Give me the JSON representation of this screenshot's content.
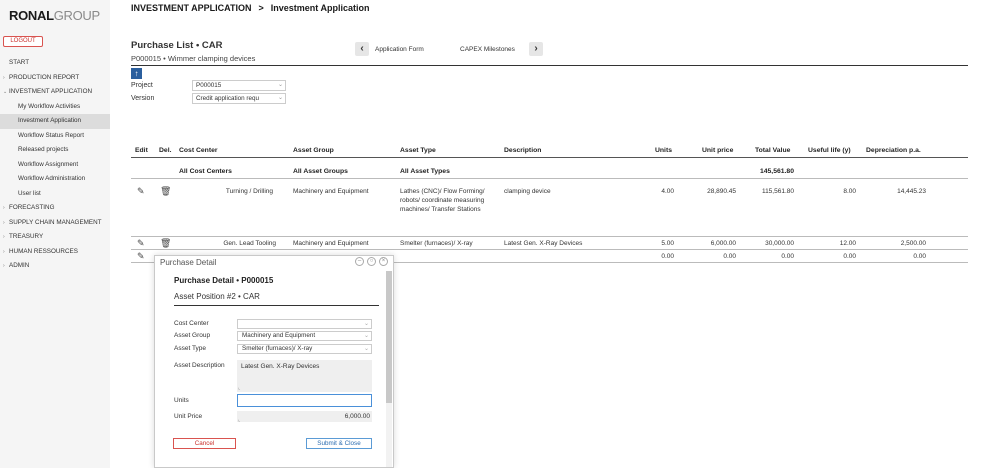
{
  "sidebar": {
    "logo_bold": "RONAL",
    "logo_light": "GROUP",
    "logout_label": "LOGOUT",
    "items": [
      {
        "label": "START"
      },
      {
        "label": "PRODUCTION REPORT"
      },
      {
        "label": "INVESTMENT APPLICATION"
      },
      {
        "label": "My Workflow Activities"
      },
      {
        "label": "Investment Application"
      },
      {
        "label": "Workflow Status Report"
      },
      {
        "label": "Released projects"
      },
      {
        "label": "Workflow Assignment"
      },
      {
        "label": "Workflow Administration"
      },
      {
        "label": "User list"
      },
      {
        "label": "FORECASTING"
      },
      {
        "label": "SUPPLY CHAIN MANAGEMENT"
      },
      {
        "label": "TREASURY"
      },
      {
        "label": "HUMAN RESSOURCES"
      },
      {
        "label": "ADMIN"
      }
    ]
  },
  "header": {
    "breadcrumb_1": "INVESTMENT APPLICATION",
    "separator": ">",
    "breadcrumb_2": "Investment Application"
  },
  "page": {
    "title": "Purchase List • CAR",
    "subtitle": "P000015 • Wimmer clamping devices",
    "prev_label": "Application Form",
    "next_label": "CAPEX Milestones"
  },
  "filters": {
    "project_label": "Project",
    "project_value": "P000015",
    "version_label": "Version",
    "version_value": "Credit application requ"
  },
  "table": {
    "headers": [
      "Edit",
      "Del.",
      "Cost Center",
      "Asset Group",
      "Asset Type",
      "Description",
      "Units",
      "Unit price",
      "Total Value",
      "Useful life (y)",
      "Depreciation p.a."
    ],
    "totals": {
      "cost_center": "All Cost Centers",
      "asset_group": "All Asset Groups",
      "asset_type": "All Asset Types",
      "total_value": "145,561.80"
    },
    "rows": [
      {
        "cost_center": "Turning / Drilling",
        "asset_group": "Machinery and Equipment",
        "asset_type_1": "Lathes (CNC)/ Flow Forming/",
        "asset_type_2": "robots/ coordinate measuring",
        "asset_type_3": "machines/ Transfer Stations",
        "description": "clamping device",
        "units": "4.00",
        "unit_price": "28,890.45",
        "total_value": "115,561.80",
        "useful_life": "8.00",
        "depreciation": "14,445.23"
      },
      {
        "cost_center": "Gen. Lead Tooling",
        "asset_group": "Machinery and Equipment",
        "asset_type_1": "Smelter (furnaces)/ X-ray",
        "description": "Latest Gen. X-Ray Devices",
        "units": "5.00",
        "unit_price": "6,000.00",
        "total_value": "30,000.00",
        "useful_life": "12.00",
        "depreciation": "2,500.00"
      },
      {
        "units": "0.00",
        "unit_price": "0.00",
        "total_value": "0.00",
        "useful_life": "0.00",
        "depreciation": "0.00"
      }
    ]
  },
  "dialog": {
    "title": "Purchase Detail",
    "heading": "Purchase Detail • P000015",
    "subheading": "Asset Position #2 • CAR",
    "cost_center_label": "Cost Center",
    "cost_center_value": "",
    "asset_group_label": "Asset Group",
    "asset_group_value": "Machinery and Equipment",
    "asset_type_label": "Asset Type",
    "asset_type_value": "Smelter (furnaces)/ X-ray",
    "description_label": "Asset Description",
    "description_value": "Latest Gen. X-Ray Devices",
    "units_label": "Units",
    "units_value": "",
    "unit_price_label": "Unit Price",
    "unit_price_value": "6,000.00",
    "cancel_label": "Cancel",
    "submit_label": "Submit & Close"
  }
}
